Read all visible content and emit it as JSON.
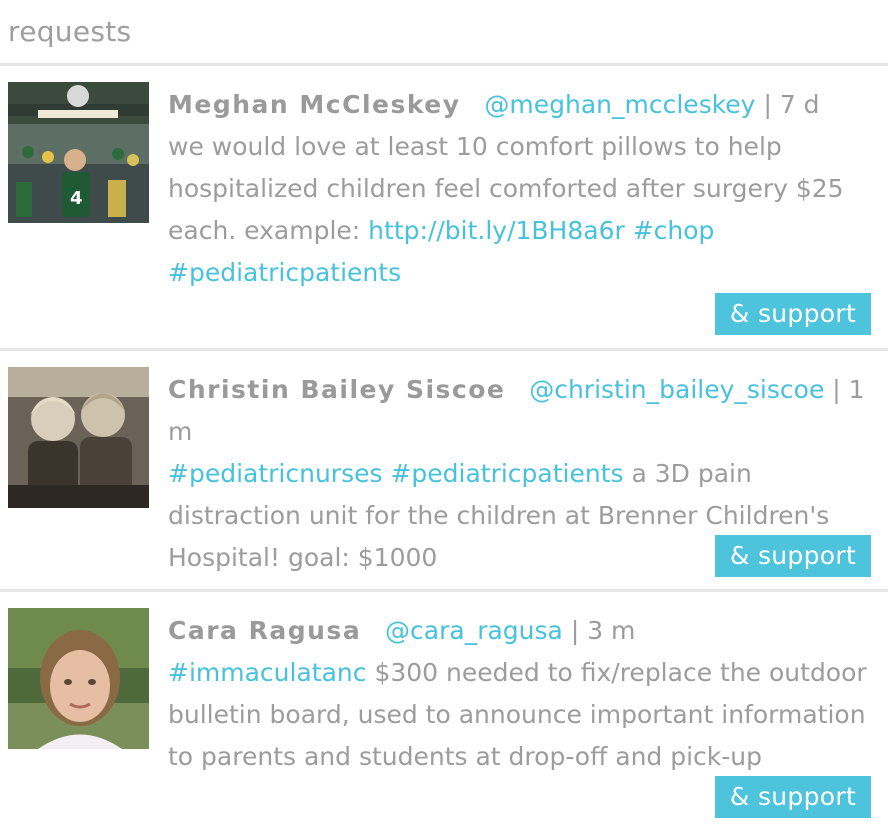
{
  "section": {
    "title": "requests"
  },
  "requests": [
    {
      "name": "Meghan McCleskey",
      "handle": "@meghan_mccleskey",
      "separator": "|",
      "time": "7 d",
      "text_before": "we would love at least 10 comfort pillows to help hospitalized children feel comforted after surgery $25 each. example:",
      "link": "http://bit.ly/1BH8a6r",
      "tags_after": "#chop #pediatricpatients",
      "button": "& support",
      "avatar_icon": "photo-stadium-fan"
    },
    {
      "name": "Christin Bailey Siscoe",
      "handle": "@christin_bailey_siscoe",
      "separator": "|",
      "time": "1 m",
      "tags_before": "#pediatricnurses #pediatricpatients",
      "text_after": "a 3D pain distraction unit for the children at Brenner Children's Hospital! goal: $1000",
      "button": "& support",
      "avatar_icon": "photo-two-children"
    },
    {
      "name": "Cara Ragusa",
      "handle": "@cara_ragusa",
      "separator": "|",
      "time": "3 m",
      "tags_before": "#immaculatanc",
      "text_after": "$300 needed to fix/replace the outdoor bulletin board, used to announce important information to parents and students at drop-off and pick-up",
      "button": "& support",
      "avatar_icon": "photo-woman-portrait"
    }
  ],
  "colors": {
    "accent": "#48c2dc",
    "button_bg": "#4ec3dc",
    "text": "#9c9c9c",
    "divider": "#e6e6e6"
  }
}
